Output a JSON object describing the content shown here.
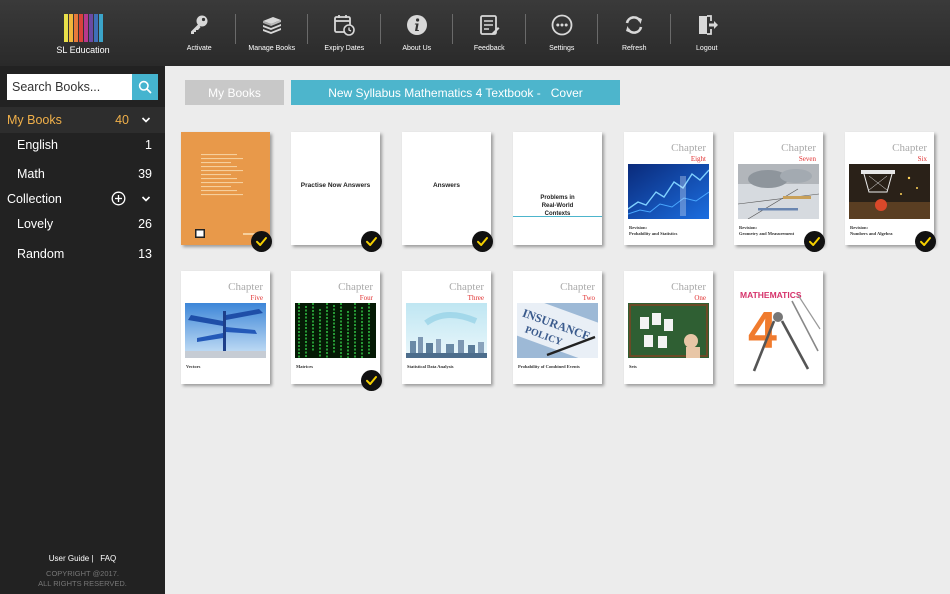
{
  "app": {
    "logo_text": "SL Education",
    "logo_colors": [
      "#e8e04a",
      "#f1b73c",
      "#e67a3a",
      "#d8423a",
      "#b8388b",
      "#6a4aa3",
      "#3f6fb8",
      "#3ba4c9"
    ]
  },
  "toolbar": {
    "items": [
      {
        "label": "Activate",
        "icon": "key-icon"
      },
      {
        "label": "Manage Books",
        "icon": "books-stack-icon"
      },
      {
        "label": "Expiry Dates",
        "icon": "calendar-clock-icon"
      },
      {
        "label": "About Us",
        "icon": "info-icon"
      },
      {
        "label": "Feedback",
        "icon": "feedback-form-icon"
      },
      {
        "label": "Settings",
        "icon": "more-dots-icon"
      },
      {
        "label": "Refresh",
        "icon": "refresh-icon"
      },
      {
        "label": "Logout",
        "icon": "logout-door-icon"
      }
    ]
  },
  "sidebar": {
    "search_placeholder": "Search Books...",
    "my_books": {
      "label": "My Books",
      "count": "40"
    },
    "subjects": [
      {
        "label": "English",
        "count": "1"
      },
      {
        "label": "Math",
        "count": "39"
      }
    ],
    "collection_label": "Collection",
    "collections": [
      {
        "label": "Lovely",
        "count": "26"
      },
      {
        "label": "Random",
        "count": "13"
      }
    ],
    "footer": {
      "user_guide": "User Guide",
      "divider": "|",
      "faq": "FAQ",
      "copyright_1": "COPYRIGHT @2017.",
      "copyright_2": "ALL RIGHTS RESERVED."
    }
  },
  "breadcrumb": {
    "root": "My Books",
    "title": "New Syllabus Mathematics 4 Textbook -   Cover"
  },
  "colors": {
    "accent": "#4db5cc",
    "active_text": "#f0b04a",
    "chapter_red": "#e03030",
    "check_yellow": "#f5d000"
  },
  "books": [
    {
      "kind": "orange-cover",
      "checked": true
    },
    {
      "kind": "title",
      "title": "Practise Now Answers",
      "checked": true
    },
    {
      "kind": "title",
      "title": "Answers",
      "checked": true
    },
    {
      "kind": "problems",
      "title": "Problems in Real-World Contexts",
      "checked": false
    },
    {
      "kind": "chapter",
      "word": "Chapter",
      "num": "Eight",
      "sub1": "Revision:",
      "sub2": "Probability and Statistics",
      "img": "stats",
      "checked": false
    },
    {
      "kind": "chapter",
      "word": "Chapter",
      "num": "Seven",
      "sub1": "Revision:",
      "sub2": "Geometry and Measurement",
      "img": "geometry",
      "checked": true
    },
    {
      "kind": "chapter",
      "word": "Chapter",
      "num": "Six",
      "sub1": "Revision:",
      "sub2": "Numbers and Algebra",
      "img": "basketball",
      "checked": true
    },
    {
      "kind": "chapter",
      "word": "Chapter",
      "num": "Five",
      "sub1": "Vectors",
      "sub2": "",
      "img": "signpost",
      "checked": false
    },
    {
      "kind": "chapter",
      "word": "Chapter",
      "num": "Four",
      "sub1": "Matrices",
      "sub2": "",
      "img": "matrix",
      "checked": true
    },
    {
      "kind": "chapter",
      "word": "Chapter",
      "num": "Three",
      "sub1": "Statistical Data Analysis",
      "sub2": "",
      "img": "city",
      "checked": false
    },
    {
      "kind": "chapter",
      "word": "Chapter",
      "num": "Two",
      "sub1": "Probability of Combined Events",
      "sub2": "",
      "img": "insurance",
      "checked": false
    },
    {
      "kind": "chapter",
      "word": "Chapter",
      "num": "One",
      "sub1": "Sets",
      "sub2": "",
      "img": "sets",
      "checked": false
    },
    {
      "kind": "math-cover",
      "title": "MATHEMATICS",
      "big": "4",
      "checked": false
    }
  ]
}
